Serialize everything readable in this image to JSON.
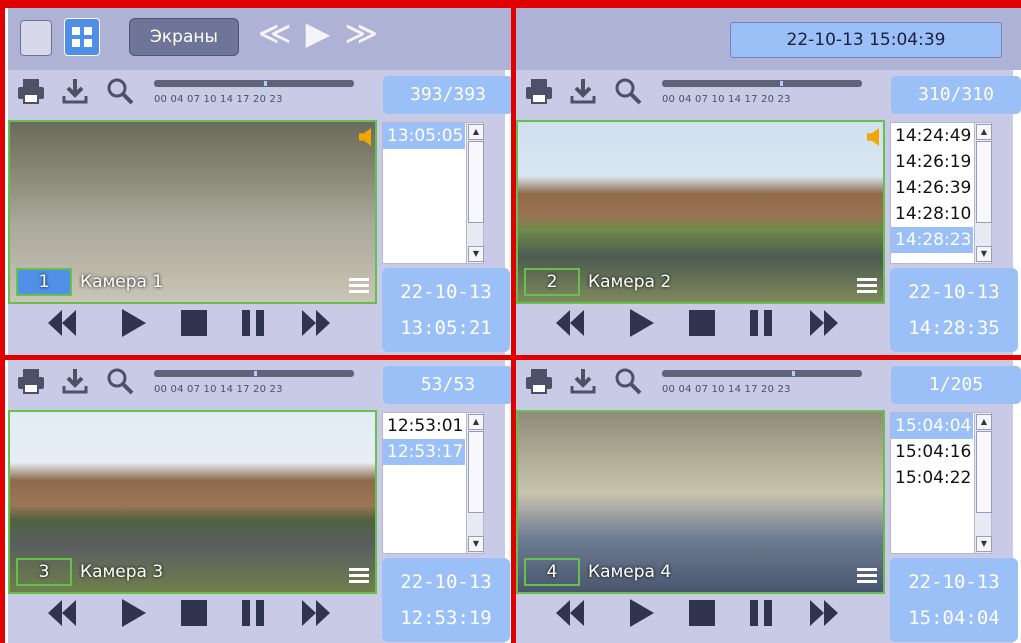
{
  "toolbar": {
    "screens_label": "Экраны",
    "nav_glyphs": "≪ ▶ ≫",
    "datetime": "22-10-13  15:04:39"
  },
  "timeline_ticks": "00  04 07 10   14  17  20 23",
  "colors": {
    "accent": "#9bc0f7",
    "frame": "#64c24a",
    "separator": "#e00000"
  },
  "panels": [
    {
      "counter": "393/393",
      "camera_number": "1",
      "camera_name": "Камера 1",
      "times": [
        "13:05:05"
      ],
      "selected_time": "13:05:05",
      "date": "22-10-13",
      "time": "13:05:21",
      "has_sound": true
    },
    {
      "counter": "310/310",
      "camera_number": "2",
      "camera_name": "Камера 2",
      "times": [
        "14:24:49",
        "14:26:19",
        "14:26:39",
        "14:28:10",
        "14:28:23"
      ],
      "selected_time": "14:28:23",
      "date": "22-10-13",
      "time": "14:28:35",
      "has_sound": true
    },
    {
      "counter": "53/53",
      "camera_number": "3",
      "camera_name": "Камера 3",
      "times": [
        "12:53:01",
        "12:53:17"
      ],
      "selected_time": "12:53:17",
      "date": "22-10-13",
      "time": "12:53:19",
      "has_sound": false
    },
    {
      "counter": "1/205",
      "camera_number": "4",
      "camera_name": "Камера 4",
      "times": [
        "15:04:04",
        "15:04:16",
        "15:04:22"
      ],
      "selected_time": "15:04:04",
      "date": "22-10-13",
      "time": "15:04:04",
      "has_sound": false
    }
  ],
  "icons": [
    "print-icon",
    "download-icon",
    "search-icon",
    "rewind-icon",
    "play-icon",
    "stop-icon",
    "pause-icon",
    "forward-icon",
    "menu-icon",
    "speaker-icon"
  ]
}
